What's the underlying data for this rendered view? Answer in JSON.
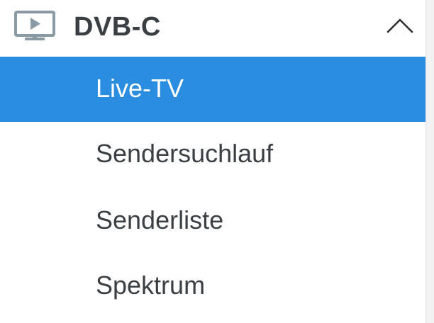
{
  "header": {
    "title": "DVB-C",
    "icon": "play-screen-icon",
    "expanded": true,
    "chevron_icon": "chevron-up-icon"
  },
  "menu": {
    "items": [
      {
        "label": "Live-TV",
        "active": true
      },
      {
        "label": "Sendersuchlauf",
        "active": false
      },
      {
        "label": "Senderliste",
        "active": false
      },
      {
        "label": "Spektrum",
        "active": false
      }
    ]
  },
  "colors": {
    "active_background": "#2a8de0",
    "active_text": "#ffffff",
    "text": "#3a3f44",
    "icon": "#8a9aa4"
  }
}
